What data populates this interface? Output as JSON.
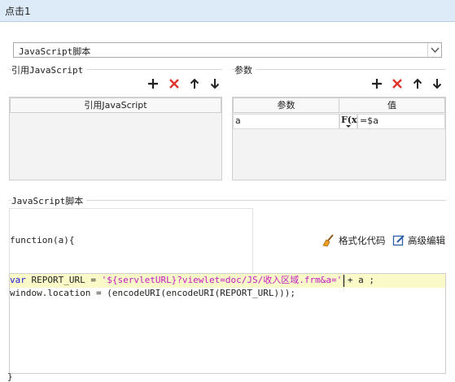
{
  "title": "点击1",
  "script_type": {
    "selected": "JavaScript脚本"
  },
  "ref_section": {
    "label": "引用JavaScript",
    "column_header": "引用JavaScript"
  },
  "params_section": {
    "label": "参数",
    "columns": [
      "参数",
      "值"
    ],
    "rows": [
      {
        "name": "a",
        "formula_icon": "F(x)",
        "value": "=$a"
      }
    ]
  },
  "script_section": {
    "label": "JavaScript脚本",
    "function_header": "function(a){",
    "format_button": "格式化代码",
    "advanced_button": "高级编辑",
    "code": {
      "line1": {
        "kw": "var",
        "ident": " REPORT_URL = ",
        "str": "'${servletURL}?viewlet=doc/JS/收入区域.frm&a='",
        "rest": " + a ;"
      },
      "line2": "window.location = (encodeURI(encodeURI(REPORT_URL)));"
    },
    "closing_brace": "}"
  },
  "icons": {
    "add": "add-icon",
    "delete": "delete-icon",
    "up": "arrow-up-icon",
    "down": "arrow-down-icon",
    "format": "broom-icon",
    "advanced": "edit-icon",
    "dropdown": "chevron-down-icon",
    "formula": "formula-icon"
  },
  "colors": {
    "delete": "#e0332c",
    "keyword": "#1b1bd6",
    "string": "#c21ac2",
    "highlight": "#fafac8"
  }
}
